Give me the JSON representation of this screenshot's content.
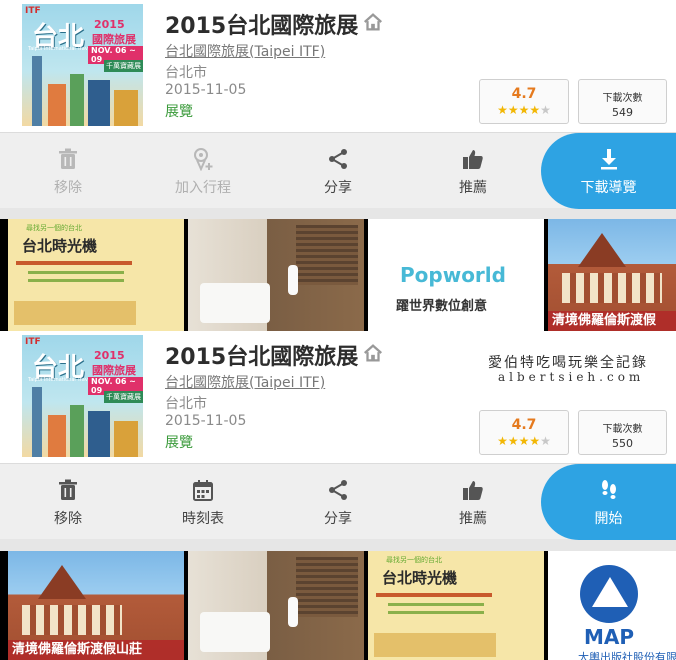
{
  "entries": [
    {
      "title": "2015台北國際旅展",
      "organizer": "台北國際旅展(Taipei ITF)",
      "city": "台北市",
      "date": "2015-11-05",
      "category": "展覽",
      "rating": "4.7",
      "stars": 4.7,
      "downloads_label": "下載次數",
      "downloads": "549",
      "actions": [
        "移除",
        "加入行程",
        "分享",
        "推薦"
      ],
      "primary_action": "下載導覽"
    },
    {
      "title": "2015台北國際旅展",
      "organizer": "台北國際旅展(Taipei ITF)",
      "city": "台北市",
      "date": "2015-11-05",
      "category": "展覽",
      "rating": "4.7",
      "stars": 4.7,
      "downloads_label": "下載次數",
      "downloads": "550",
      "actions": [
        "移除",
        "時刻表",
        "分享",
        "推薦"
      ],
      "primary_action": "開始"
    }
  ],
  "cover": {
    "brand": "ITF",
    "calligraphy": "台北",
    "year": "2015",
    "name": "國際旅展",
    "dates": "NOV. 06 ~ 09",
    "english": "Taipei International Travel Fair",
    "tag": "千萬寶藏展"
  },
  "thumbnails": {
    "poster_title": "台北時光機",
    "poster_subtitle": "尋找另一個的台北",
    "popworld_logo": "Popworld",
    "popworld_tagline": "躍世界數位創意",
    "castle_caption_1": "清境佛羅倫斯渡假",
    "castle_caption_2": "清境佛羅倫斯渡假山莊",
    "map_logo": "MAP",
    "map_text": "大輿出版社股份有限公司"
  },
  "watermark": {
    "line1": "愛伯特吃喝玩樂全記錄",
    "line2": "albertsieh.com"
  },
  "colors": {
    "accent": "#2ea3e3",
    "rating": "#e57a1e",
    "category": "#3a9a3a",
    "star": "#f2b705"
  }
}
